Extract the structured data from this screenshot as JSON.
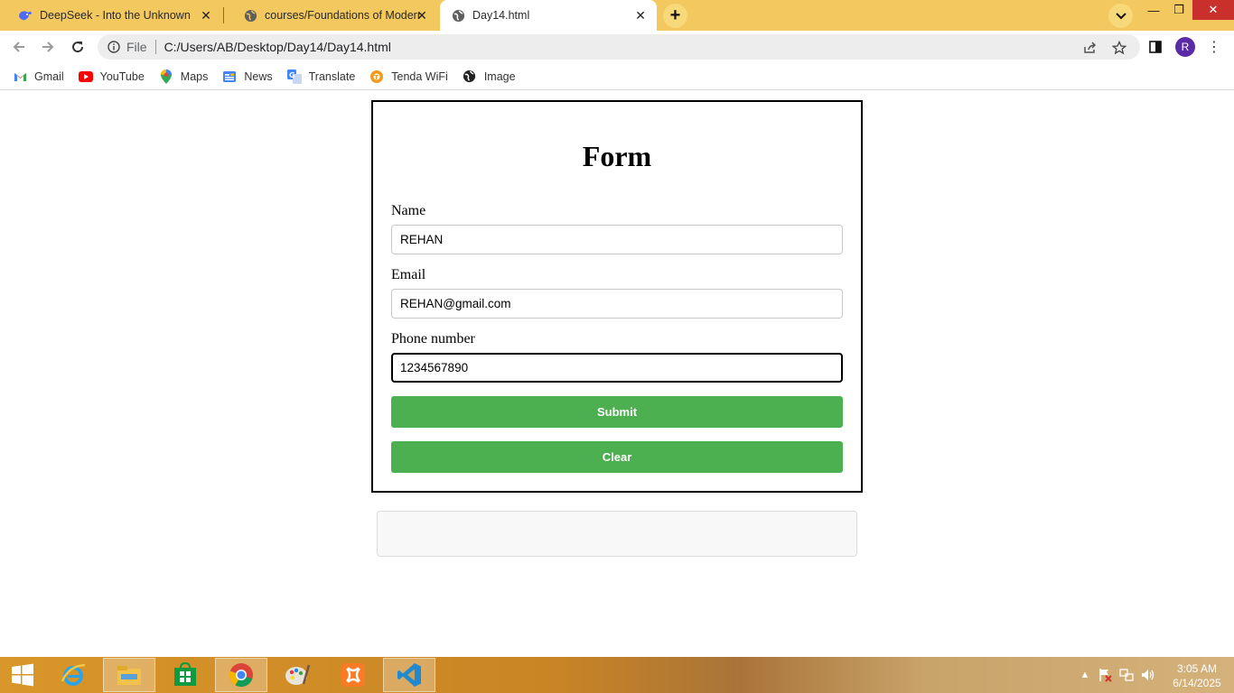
{
  "browser": {
    "tabs": [
      {
        "title": "DeepSeek - Into the Unknown",
        "active": false,
        "icon": "deepseek-whale-icon"
      },
      {
        "title": "courses/Foundations of Modern",
        "active": false,
        "icon": "globe-icon"
      },
      {
        "title": "Day14.html",
        "active": true,
        "icon": "globe-icon"
      }
    ],
    "address": {
      "scheme_label": "File",
      "url": "C:/Users/AB/Desktop/Day14/Day14.html"
    },
    "profile_initial": "R",
    "bookmarks": [
      {
        "label": "Gmail",
        "icon": "gmail-icon"
      },
      {
        "label": "YouTube",
        "icon": "youtube-icon"
      },
      {
        "label": "Maps",
        "icon": "maps-pin-icon"
      },
      {
        "label": "News",
        "icon": "news-icon"
      },
      {
        "label": "Translate",
        "icon": "translate-icon"
      },
      {
        "label": "Tenda WiFi",
        "icon": "tenda-icon"
      },
      {
        "label": "Image",
        "icon": "image-globe-icon"
      }
    ]
  },
  "form": {
    "title": "Form",
    "fields": {
      "name": {
        "label": "Name",
        "value": "REHAN"
      },
      "email": {
        "label": "Email",
        "value": "REHAN@gmail.com"
      },
      "phone": {
        "label": "Phone number",
        "value": "1234567890"
      }
    },
    "submit_label": "Submit",
    "clear_label": "Clear",
    "result": ""
  },
  "colors": {
    "tabstrip": "#f2c85f",
    "button_green": "#4caf50"
  },
  "taskbar": {
    "apps": [
      "start-icon",
      "internet-explorer-icon",
      "file-explorer-icon",
      "store-icon",
      "chrome-icon",
      "paint-icon",
      "xampp-icon",
      "vscode-icon"
    ],
    "time": "3:05 AM",
    "date": "6/14/2025"
  }
}
